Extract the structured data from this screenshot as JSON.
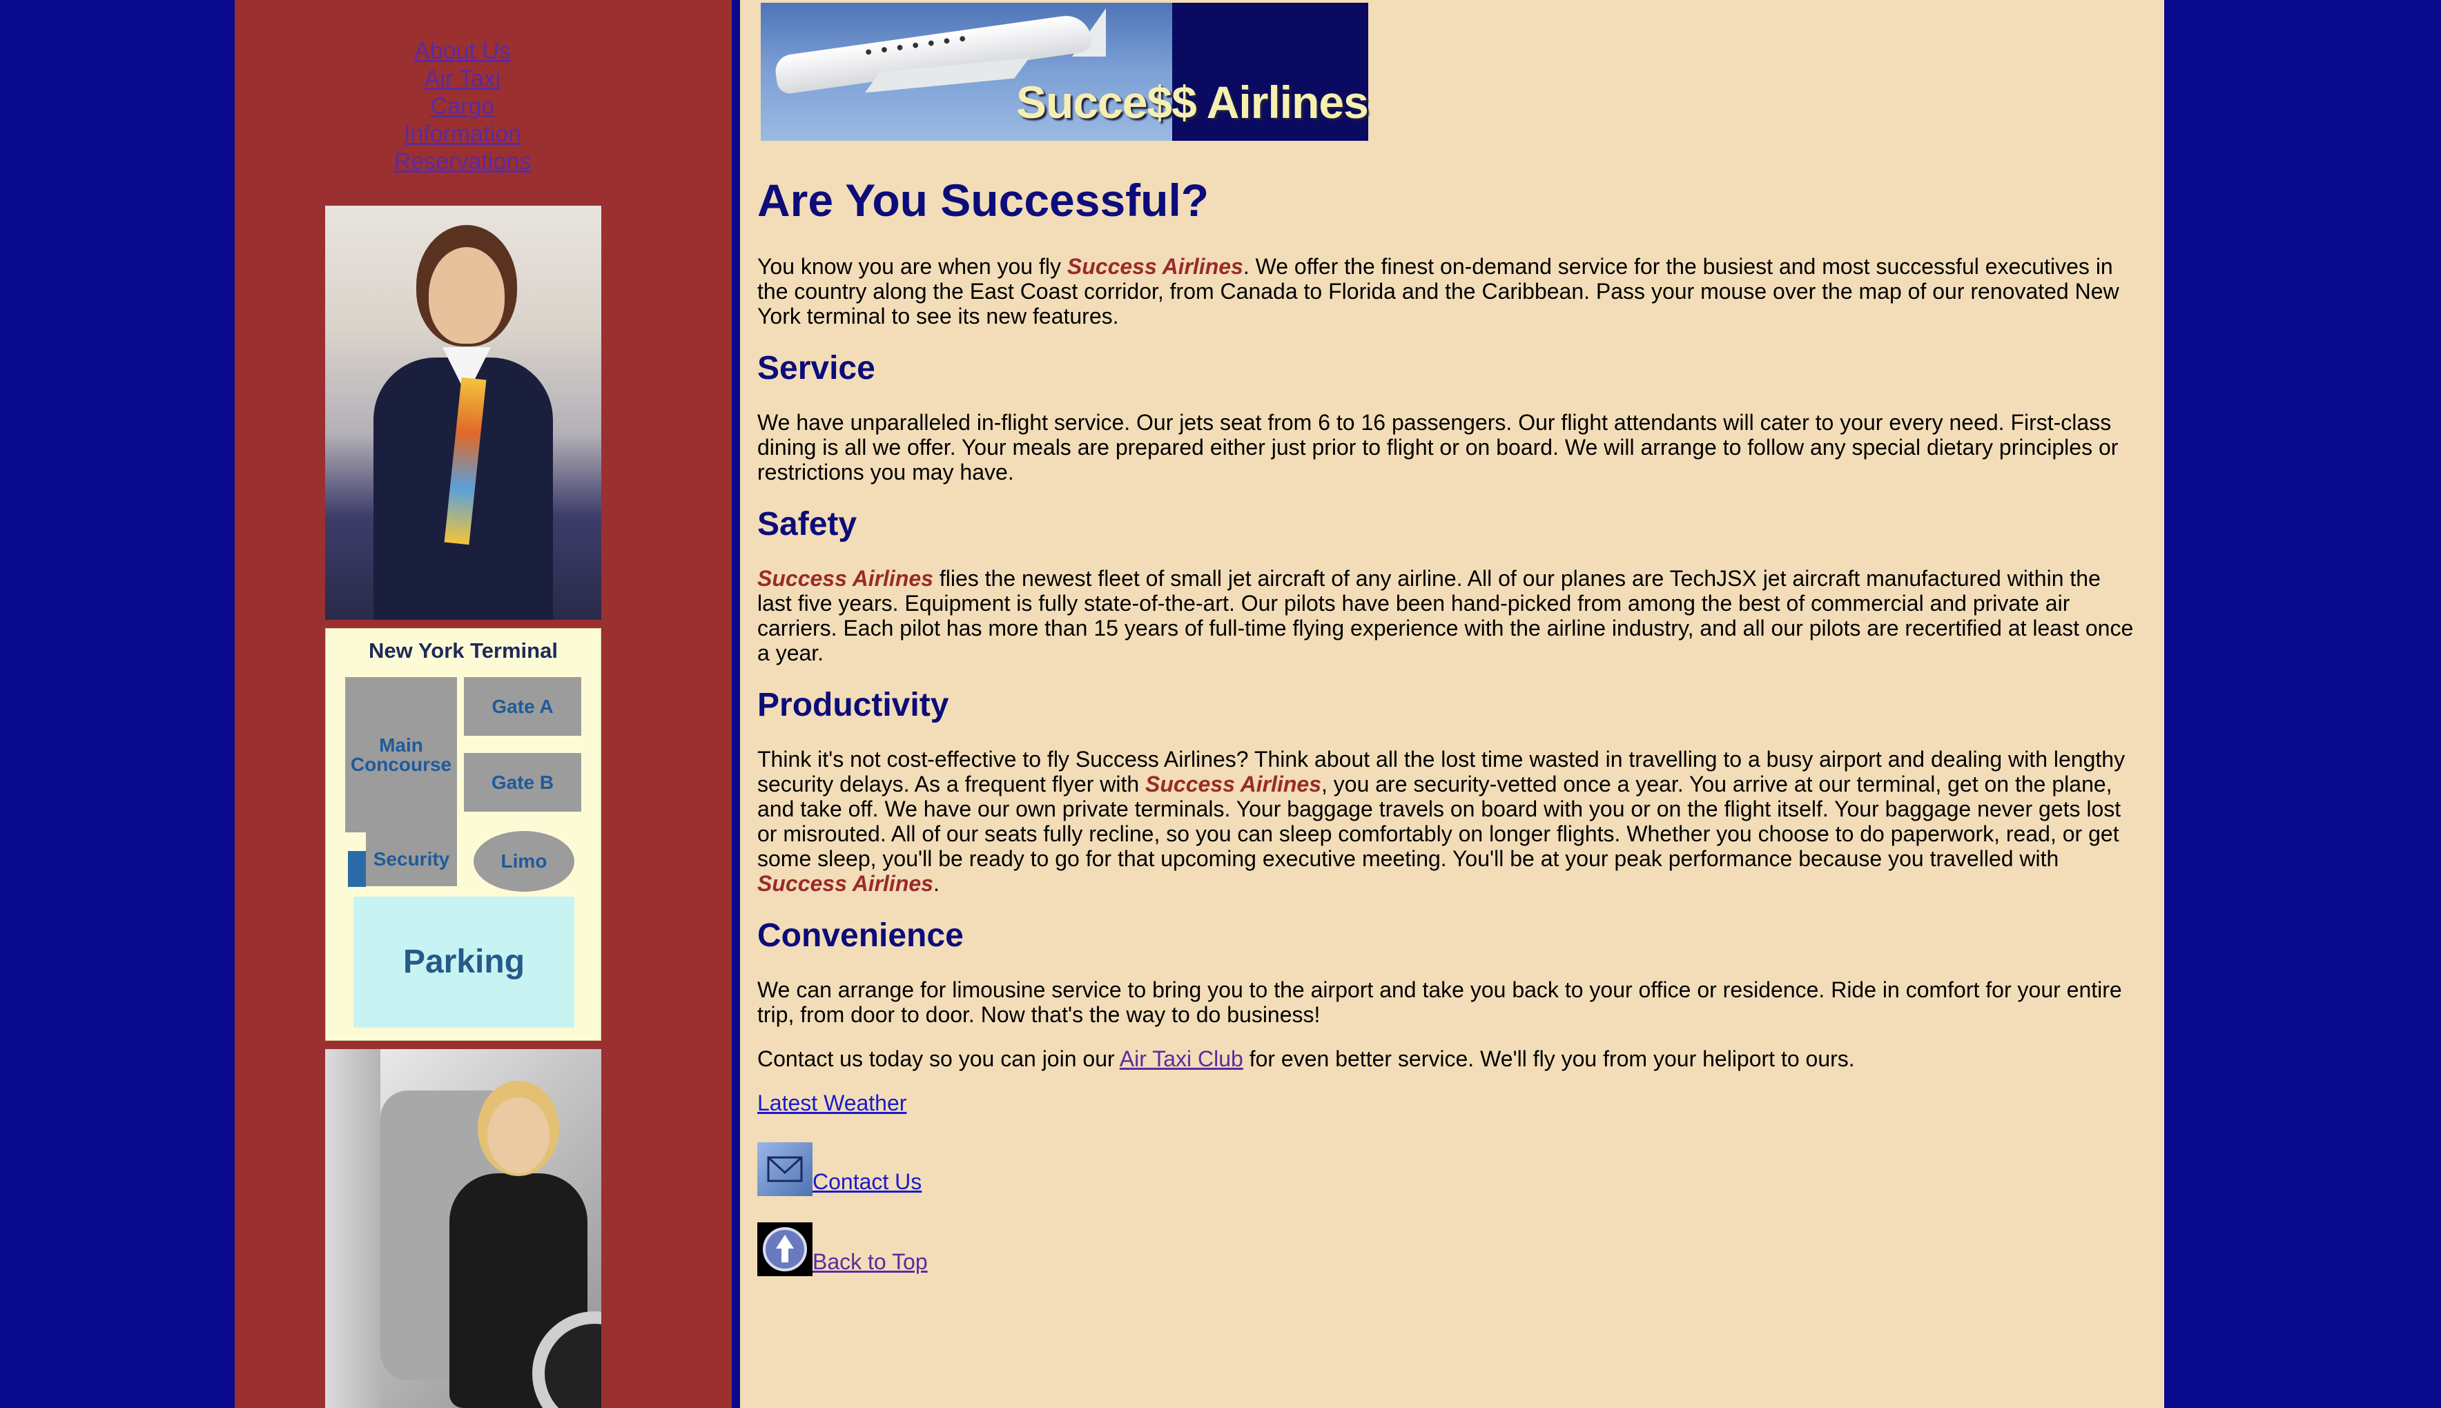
{
  "nav": {
    "items": [
      "About Us",
      "Air Taxi",
      "Cargo",
      "Information",
      "Reservations"
    ]
  },
  "map": {
    "title": "New York Terminal",
    "main_concourse": "Main Concourse",
    "gate_a": "Gate A",
    "gate_b": "Gate B",
    "security": "Security",
    "limo": "Limo",
    "parking": "Parking"
  },
  "banner": {
    "text": "Succe$$ Airlines"
  },
  "content": {
    "title": "Are You Successful?",
    "brand": "Success Airlines",
    "intro_before": "You know you are when you fly ",
    "intro_after": ". We offer the finest on-demand service for the busiest and most successful executives in the country along the East Coast corridor, from Canada to Florida and the Caribbean. Pass your mouse over the map of our renovated New York terminal to see its new features.",
    "service_heading": "Service",
    "service_text": "We have unparalleled in-flight service. Our jets seat from 6 to 16 passengers. Our flight attendants will cater to your every need. First-class dining is all we offer. Your meals are prepared either just prior to flight or on board. We will arrange to follow any special dietary principles or restrictions you may have.",
    "safety_heading": "Safety",
    "safety_text": " flies the newest fleet of small jet aircraft of any airline. All of our planes are TechJSX jet aircraft manufactured within the last five years. Equipment is fully state-of-the-art. Our pilots have been hand-picked from among the best of commercial and private air carriers. Each pilot has more than 15 years of full-time flying experience with the airline industry, and all our pilots are recertified at least once a year.",
    "productivity_heading": "Productivity",
    "productivity_before": "Think it's not cost-effective to fly Success Airlines? Think about all the lost time wasted in travelling to a busy airport and dealing with lengthy security delays. As a frequent flyer with ",
    "productivity_after": ", you are security-vetted once a year. You arrive at our terminal, get on the plane, and take off. We have our own private terminals. Your baggage travels on board with you or on the flight itself. Your baggage never gets lost or misrouted. All of our seats fully recline, so you can sleep comfortably on longer flights. Whether you choose to do paperwork, read, or get some sleep, you'll be ready to go for that upcoming executive meeting. You'll be at your peak performance because you travelled with ",
    "productivity_end": ".",
    "convenience_heading": "Convenience",
    "convenience_text": "We can arrange for limousine service to bring you to the airport and take you back to your office or residence. Ride in comfort for your entire trip, from door to door. Now that's the way to do business!",
    "contact_before": "Contact us today so you can join our ",
    "contact_link": "Air Taxi Club",
    "contact_after": " for even better service. We'll fly you from your heliport to ours.",
    "weather_link": "Latest Weather",
    "contact_us_link": "Contact Us",
    "back_to_top_link": "Back to Top"
  },
  "colors": {
    "page_bg": "#0a0a8c",
    "sidebar_bg": "#9a3030",
    "content_bg": "#f2ddb8",
    "heading": "#0c0c7a",
    "brand": "#9a2a2a"
  }
}
